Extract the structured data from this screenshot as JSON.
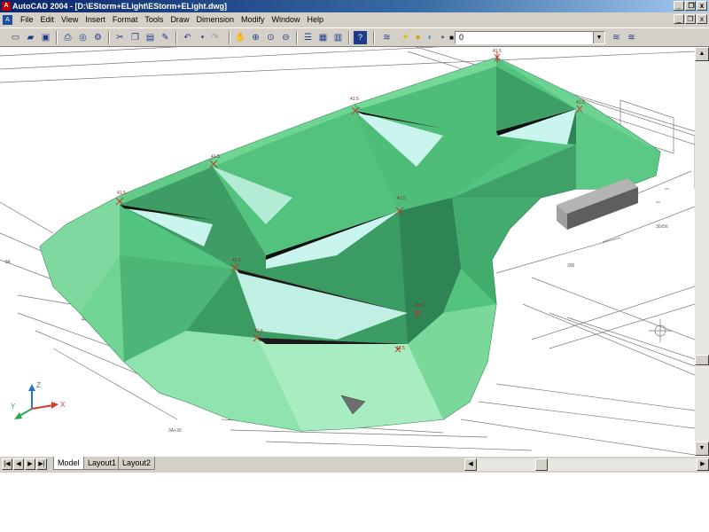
{
  "window": {
    "title": "AutoCAD 2004 - [D:\\EStorm+ELight\\EStorm+ELight.dwg]",
    "caption_buttons": [
      "_",
      " ❐",
      "x"
    ],
    "doc_caption_buttons": [
      "_",
      "❐",
      "x"
    ]
  },
  "menubar": {
    "items": [
      "File",
      "Edit",
      "View",
      "Insert",
      "Format",
      "Tools",
      "Draw",
      "Dimension",
      "Modify",
      "Window",
      "Help"
    ]
  },
  "toolbar": {
    "layer_value": "0",
    "icons": [
      "new-icon",
      "open-icon",
      "save-icon",
      "print-icon",
      "print-preview-icon",
      "publish-icon",
      "cut-icon",
      "copy-icon",
      "paste-icon",
      "match-properties-icon",
      "undo-icon",
      "redo-icon",
      "pan-icon",
      "zoom-realtime-icon",
      "zoom-window-icon",
      "zoom-previous-icon",
      "properties-icon",
      "design-center-icon",
      "tool-palettes-icon",
      "help-icon",
      "layer-manager-icon",
      "layer-state-icon",
      "make-current-layer-icon"
    ]
  },
  "drawing": {
    "spot_labels": [
      "41.5",
      "41.5",
      "41.5",
      "41.5",
      "41.5",
      "41.5",
      "41.5",
      "41.5",
      "41.5",
      "41.5"
    ],
    "ucs": {
      "x": "X",
      "y": "Y",
      "z": "Z"
    },
    "colors": {
      "surface_light": "#8de3a9",
      "surface_mid": "#52c47f",
      "surface_dark": "#2a7c50",
      "highlight": "#c9f5ee",
      "building": "#7e7e7e"
    }
  },
  "layout_tabs": {
    "tabs": [
      "Model",
      "Layout1",
      "Layout2"
    ],
    "active": "Model"
  }
}
